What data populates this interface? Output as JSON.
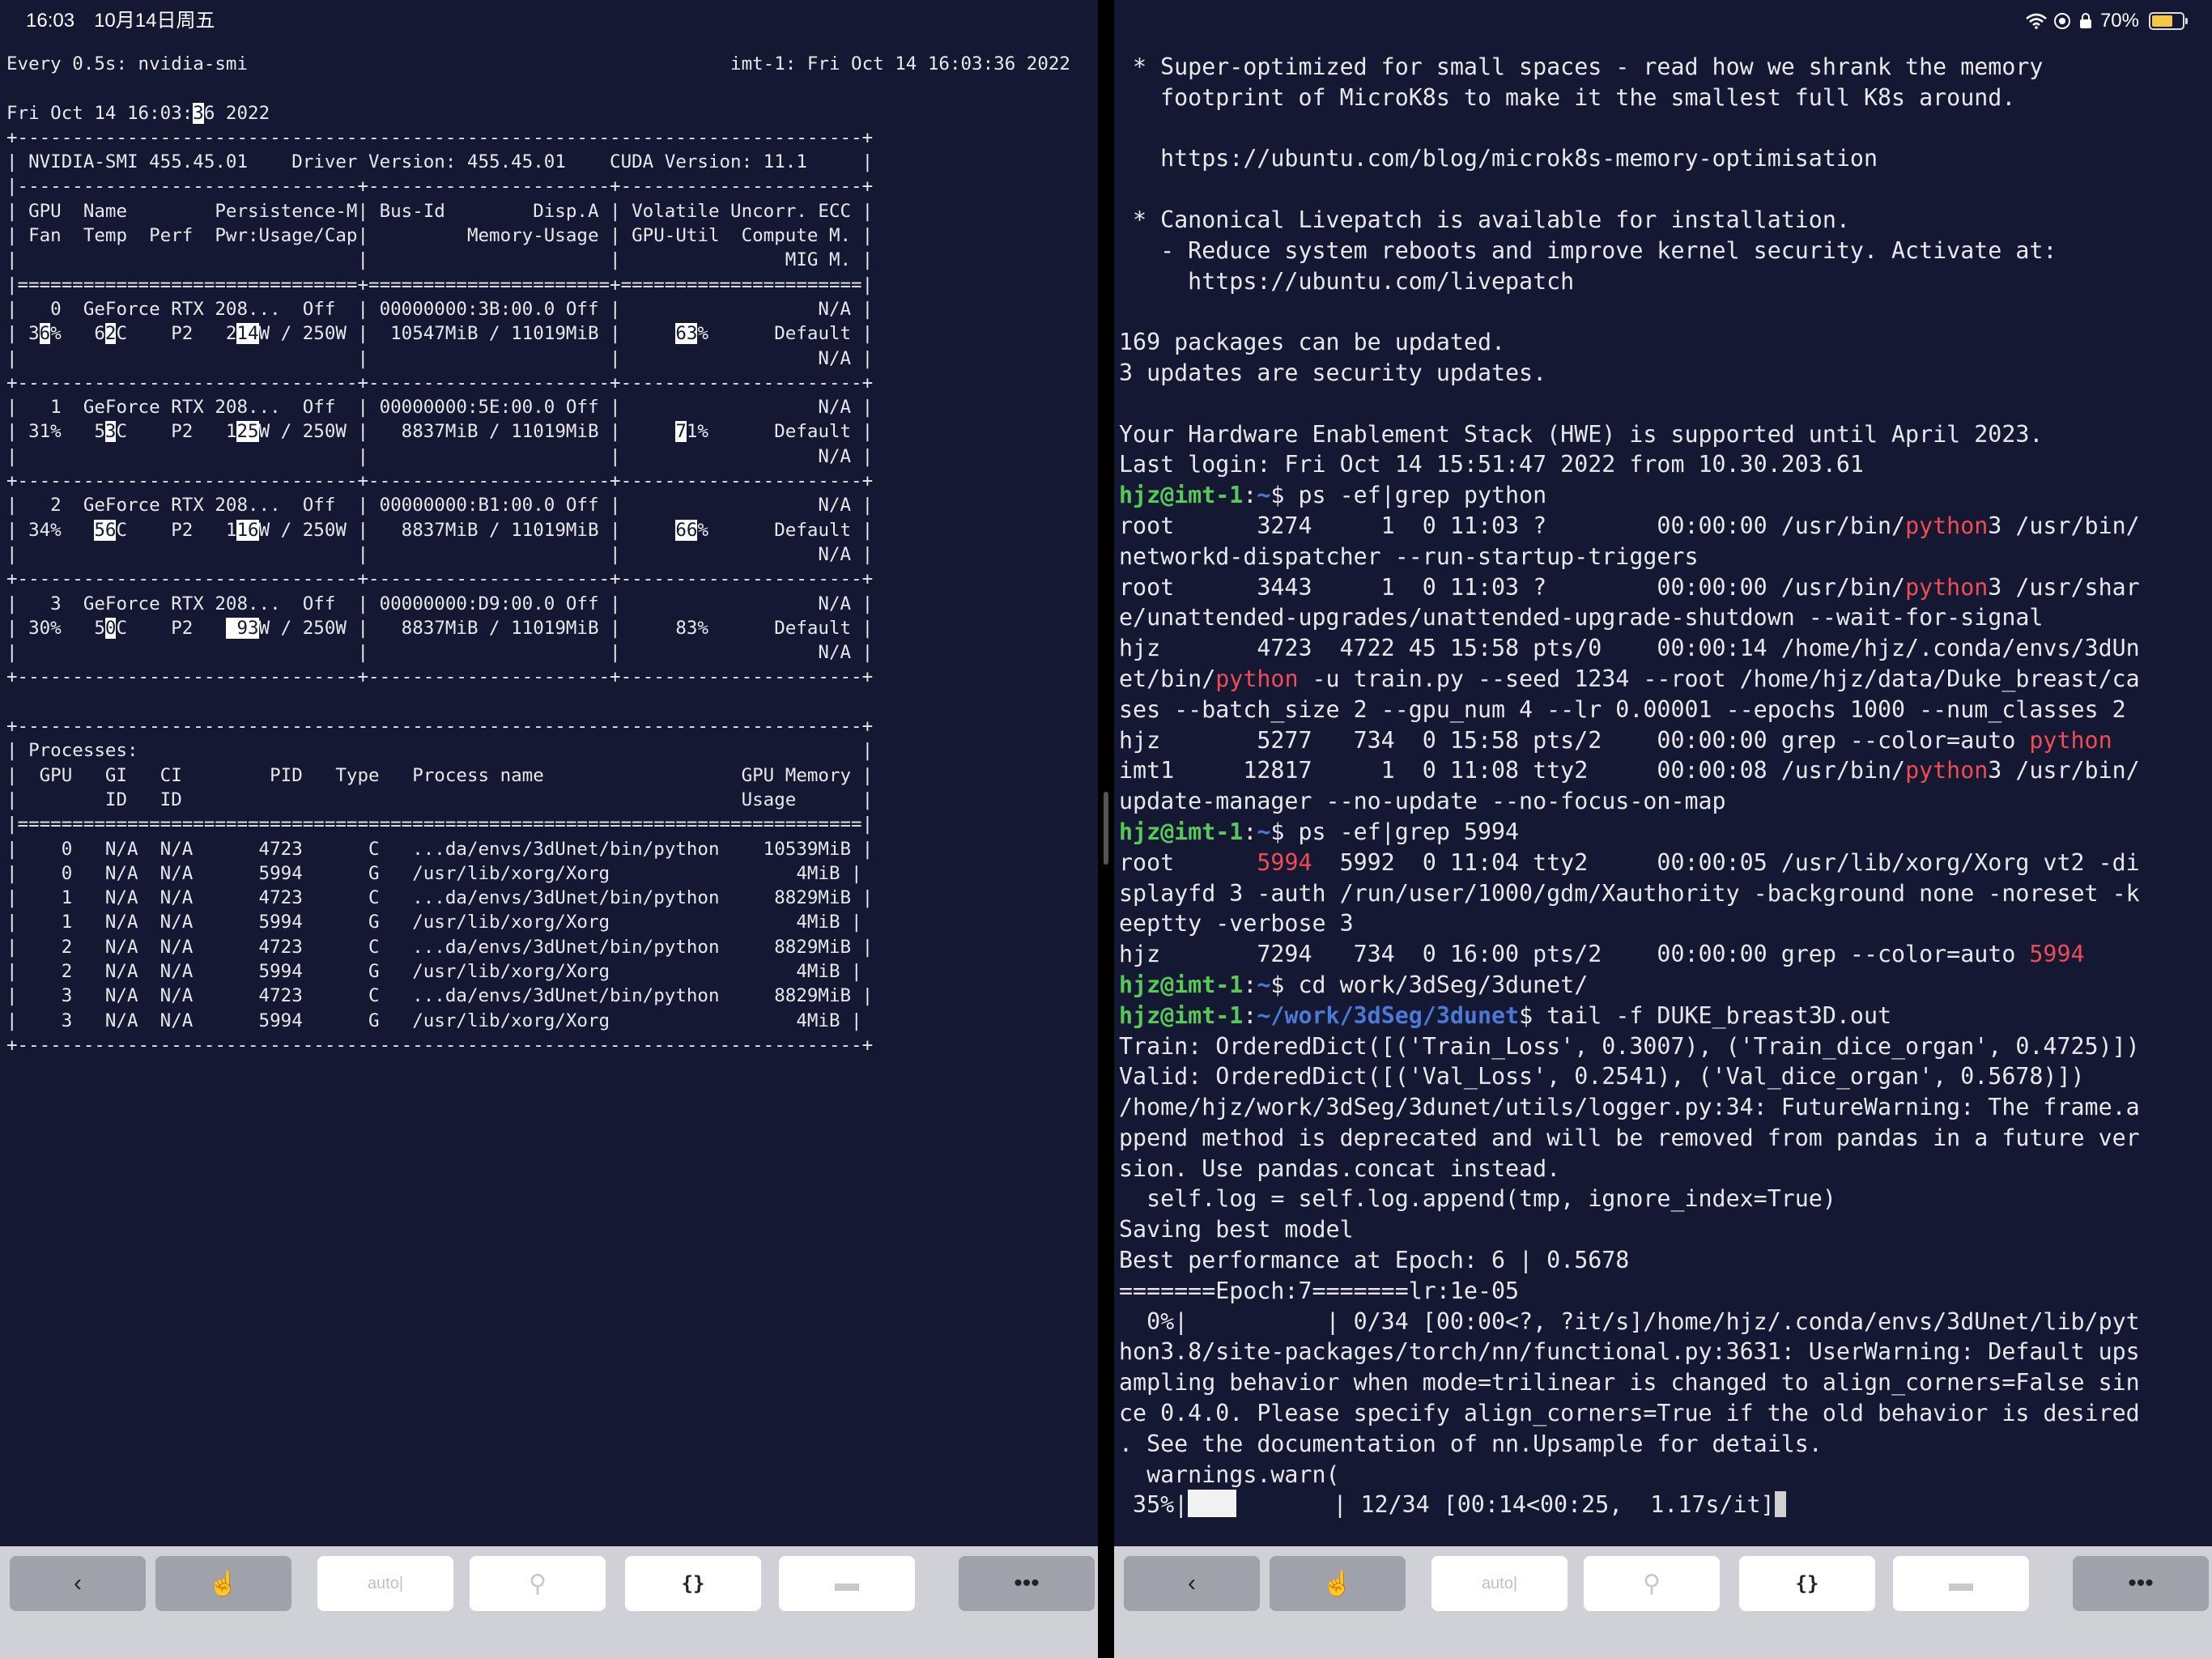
{
  "status_bar": {
    "time": "16:03",
    "date": "10月14日周五",
    "battery": "70%",
    "battery_level": 0.7
  },
  "left_terminal": {
    "lines": [
      "Every 0.5s: nvidia-smi                                            imt-1: Fri Oct 14 16:03:36 2022",
      "",
      "Fri Oct 14 16:03:[[3]]6 2022",
      "+-----------------------------------------------------------------------------+",
      "| NVIDIA-SMI 455.45.01    Driver Version: 455.45.01    CUDA Version: 11.1     |",
      "|-------------------------------+----------------------+----------------------+",
      "| GPU  Name        Persistence-M| Bus-Id        Disp.A | Volatile Uncorr. ECC |",
      "| Fan  Temp  Perf  Pwr:Usage/Cap|         Memory-Usage | GPU-Util  Compute M. |",
      "|                               |                      |               MIG M. |",
      "|===============================+======================+======================|",
      "|   0  GeForce RTX 208...  Off  | 00000000:3B:00.0 Off |                  N/A |",
      "| 3[[6]]%   6[[2]]C    P2   2[[1]][[4]]W / 250W |  10547MiB / 11019MiB |     [[63]]%      Default |",
      "|                               |                      |                  N/A |",
      "+-------------------------------+----------------------+----------------------+",
      "|   1  GeForce RTX 208...  Off  | 00000000:5E:00.0 Off |                  N/A |",
      "| 31%   5[[3]]C    P2   1[[25]]W / 250W |   8837MiB / 11019MiB |     [[7]]1%      Default |",
      "|                               |                      |                  N/A |",
      "+-------------------------------+----------------------+----------------------+",
      "|   2  GeForce RTX 208...  Off  | 00000000:B1:00.0 Off |                  N/A |",
      "| 34%   [[56]]C    P2   1[[16]]W / 250W |   8837MiB / 11019MiB |     [[66]]%      Default |",
      "|                               |                      |                  N/A |",
      "+-------------------------------+----------------------+----------------------+",
      "|   3  GeForce RTX 208...  Off  | 00000000:D9:00.0 Off |                  N/A |",
      "| 30%   5[[0]]C    P2   [[ 93]]W / 250W |   8837MiB / 11019MiB |     83%      Default |",
      "|                               |                      |                  N/A |",
      "+-------------------------------+----------------------+----------------------+",
      "",
      "+-----------------------------------------------------------------------------+",
      "| Processes:                                                                  |",
      "|  GPU   GI   CI        PID   Type   Process name                  GPU Memory |",
      "|        ID   ID                                                   Usage      |",
      "|=============================================================================|",
      "|    0   N/A  N/A      4723      C   ...da/envs/3dUnet/bin/python    10539MiB |",
      "|    0   N/A  N/A      5994      G   /usr/lib/xorg/Xorg                 4MiB |",
      "|    1   N/A  N/A      4723      C   ...da/envs/3dUnet/bin/python     8829MiB |",
      "|    1   N/A  N/A      5994      G   /usr/lib/xorg/Xorg                 4MiB |",
      "|    2   N/A  N/A      4723      C   ...da/envs/3dUnet/bin/python     8829MiB |",
      "|    2   N/A  N/A      5994      G   /usr/lib/xorg/Xorg                 4MiB |",
      "|    3   N/A  N/A      4723      C   ...da/envs/3dUnet/bin/python     8829MiB |",
      "|    3   N/A  N/A      5994      G   /usr/lib/xorg/Xorg                 4MiB |",
      "+-----------------------------------------------------------------------------+"
    ]
  },
  "right_terminal": {
    "lines": [
      " * Super-optimized for small spaces - read how we shrank the memory",
      "   footprint of MicroK8s to make it the smallest full K8s around.",
      "",
      "   https://ubuntu.com/blog/microk8s-memory-optimisation",
      "",
      " * Canonical Livepatch is available for installation.",
      "   - Reduce system reboots and improve kernel security. Activate at:",
      "     https://ubuntu.com/livepatch",
      "",
      "169 packages can be updated.",
      "3 updates are security updates.",
      "",
      "Your Hardware Enablement Stack (HWE) is supported until April 2023.",
      "Last login: Fri Oct 14 15:51:47 2022 from 10.30.203.61",
      "{g}hjz@imt-1{/}:{b}~{/}$ ps -ef|grep python",
      "root      3274     1  0 11:03 ?        00:00:00 /usr/bin/{r}python{/}3 /usr/bin/",
      "networkd-dispatcher --run-startup-triggers",
      "root      3443     1  0 11:03 ?        00:00:00 /usr/bin/{r}python{/}3 /usr/shar",
      "e/unattended-upgrades/unattended-upgrade-shutdown --wait-for-signal",
      "hjz       4723  4722 45 15:58 pts/0    00:00:14 /home/hjz/.conda/envs/3dUn",
      "et/bin/{r}python{/} -u train.py --seed 1234 --root /home/hjz/data/Duke_breast/ca",
      "ses --batch_size 2 --gpu_num 4 --lr 0.00001 --epochs 1000 --num_classes 2",
      "hjz       5277   734  0 15:58 pts/2    00:00:00 grep --color=auto {r}python{/}",
      "imt1     12817     1  0 11:08 tty2     00:00:08 /usr/bin/{r}python{/}3 /usr/bin/",
      "update-manager --no-update --no-focus-on-map",
      "{g}hjz@imt-1{/}:{b}~{/}$ ps -ef|grep 5994",
      "root      {r}5994{/}  5992  0 11:04 tty2     00:00:05 /usr/lib/xorg/Xorg vt2 -di",
      "splayfd 3 -auth /run/user/1000/gdm/Xauthority -background none -noreset -k",
      "eeptty -verbose 3",
      "hjz       7294   734  0 16:00 pts/2    00:00:00 grep --color=auto {r}5994{/}",
      "{g}hjz@imt-1{/}:{b}~{/}$ cd work/3dSeg/3dunet/",
      "{g}hjz@imt-1{/}:{b}~/work/3dSeg/3dunet{/}$ tail -f DUKE_breast3D.out",
      "Train: OrderedDict([('Train_Loss', 0.3007), ('Train_dice_organ', 0.4725)])",
      "Valid: OrderedDict([('Val_Loss', 0.2541), ('Val_dice_organ', 0.5678)])",
      "/home/hjz/work/3dSeg/3dunet/utils/logger.py:34: FutureWarning: The frame.a",
      "ppend method is deprecated and will be removed from pandas in a future ver",
      "sion. Use pandas.concat instead.",
      "  self.log = self.log.append(tmp, ignore_index=True)",
      "Saving best model",
      "Best performance at Epoch: 6 | 0.5678",
      "=======Epoch:7=======lr:1e-05",
      "  0%|          | 0/34 [00:00<?, ?it/s]/home/hjz/.conda/envs/3dUnet/lib/pyt",
      "hon3.8/site-packages/torch/nn/functional.py:3631: UserWarning: Default ups",
      "ampling behavior when mode=trilinear is changed to align_corners=False sin",
      "ce 0.4.0. Please specify align_corners=True if the old behavior is desired",
      ". See the documentation of nn.Upsample for details.",
      "  warnings.warn(",
      " 35%|{bar}       | 12/34 [00:14<00:25,  1.17s/it]{cur}"
    ]
  },
  "keyboard_bar": {
    "buttons": [
      {
        "name": "back-button",
        "icon": "chevron-left-icon",
        "glyph": "‹",
        "style": "dark"
      },
      {
        "name": "touch-button",
        "icon": "hand-pointer-icon",
        "glyph": "☝",
        "style": "dark"
      },
      {
        "name": "auto-button",
        "label": "auto|",
        "style": "light"
      },
      {
        "name": "key-button",
        "icon": "key-icon",
        "glyph": "⚲",
        "style": "light"
      },
      {
        "name": "braces-button",
        "icon": "braces-icon",
        "glyph": "{}",
        "style": "light"
      },
      {
        "name": "folder-button",
        "icon": "folder-icon",
        "glyph": "▬",
        "style": "light"
      },
      {
        "name": "more-button",
        "icon": "ellipsis-icon",
        "glyph": "•••",
        "style": "dark"
      }
    ]
  },
  "colors": {
    "background": "#141833",
    "prompt_user": "#58c957",
    "prompt_path": "#4a7ad6",
    "grep_match": "#ef4d52",
    "keyboard_bar": "#cfd1d6"
  }
}
